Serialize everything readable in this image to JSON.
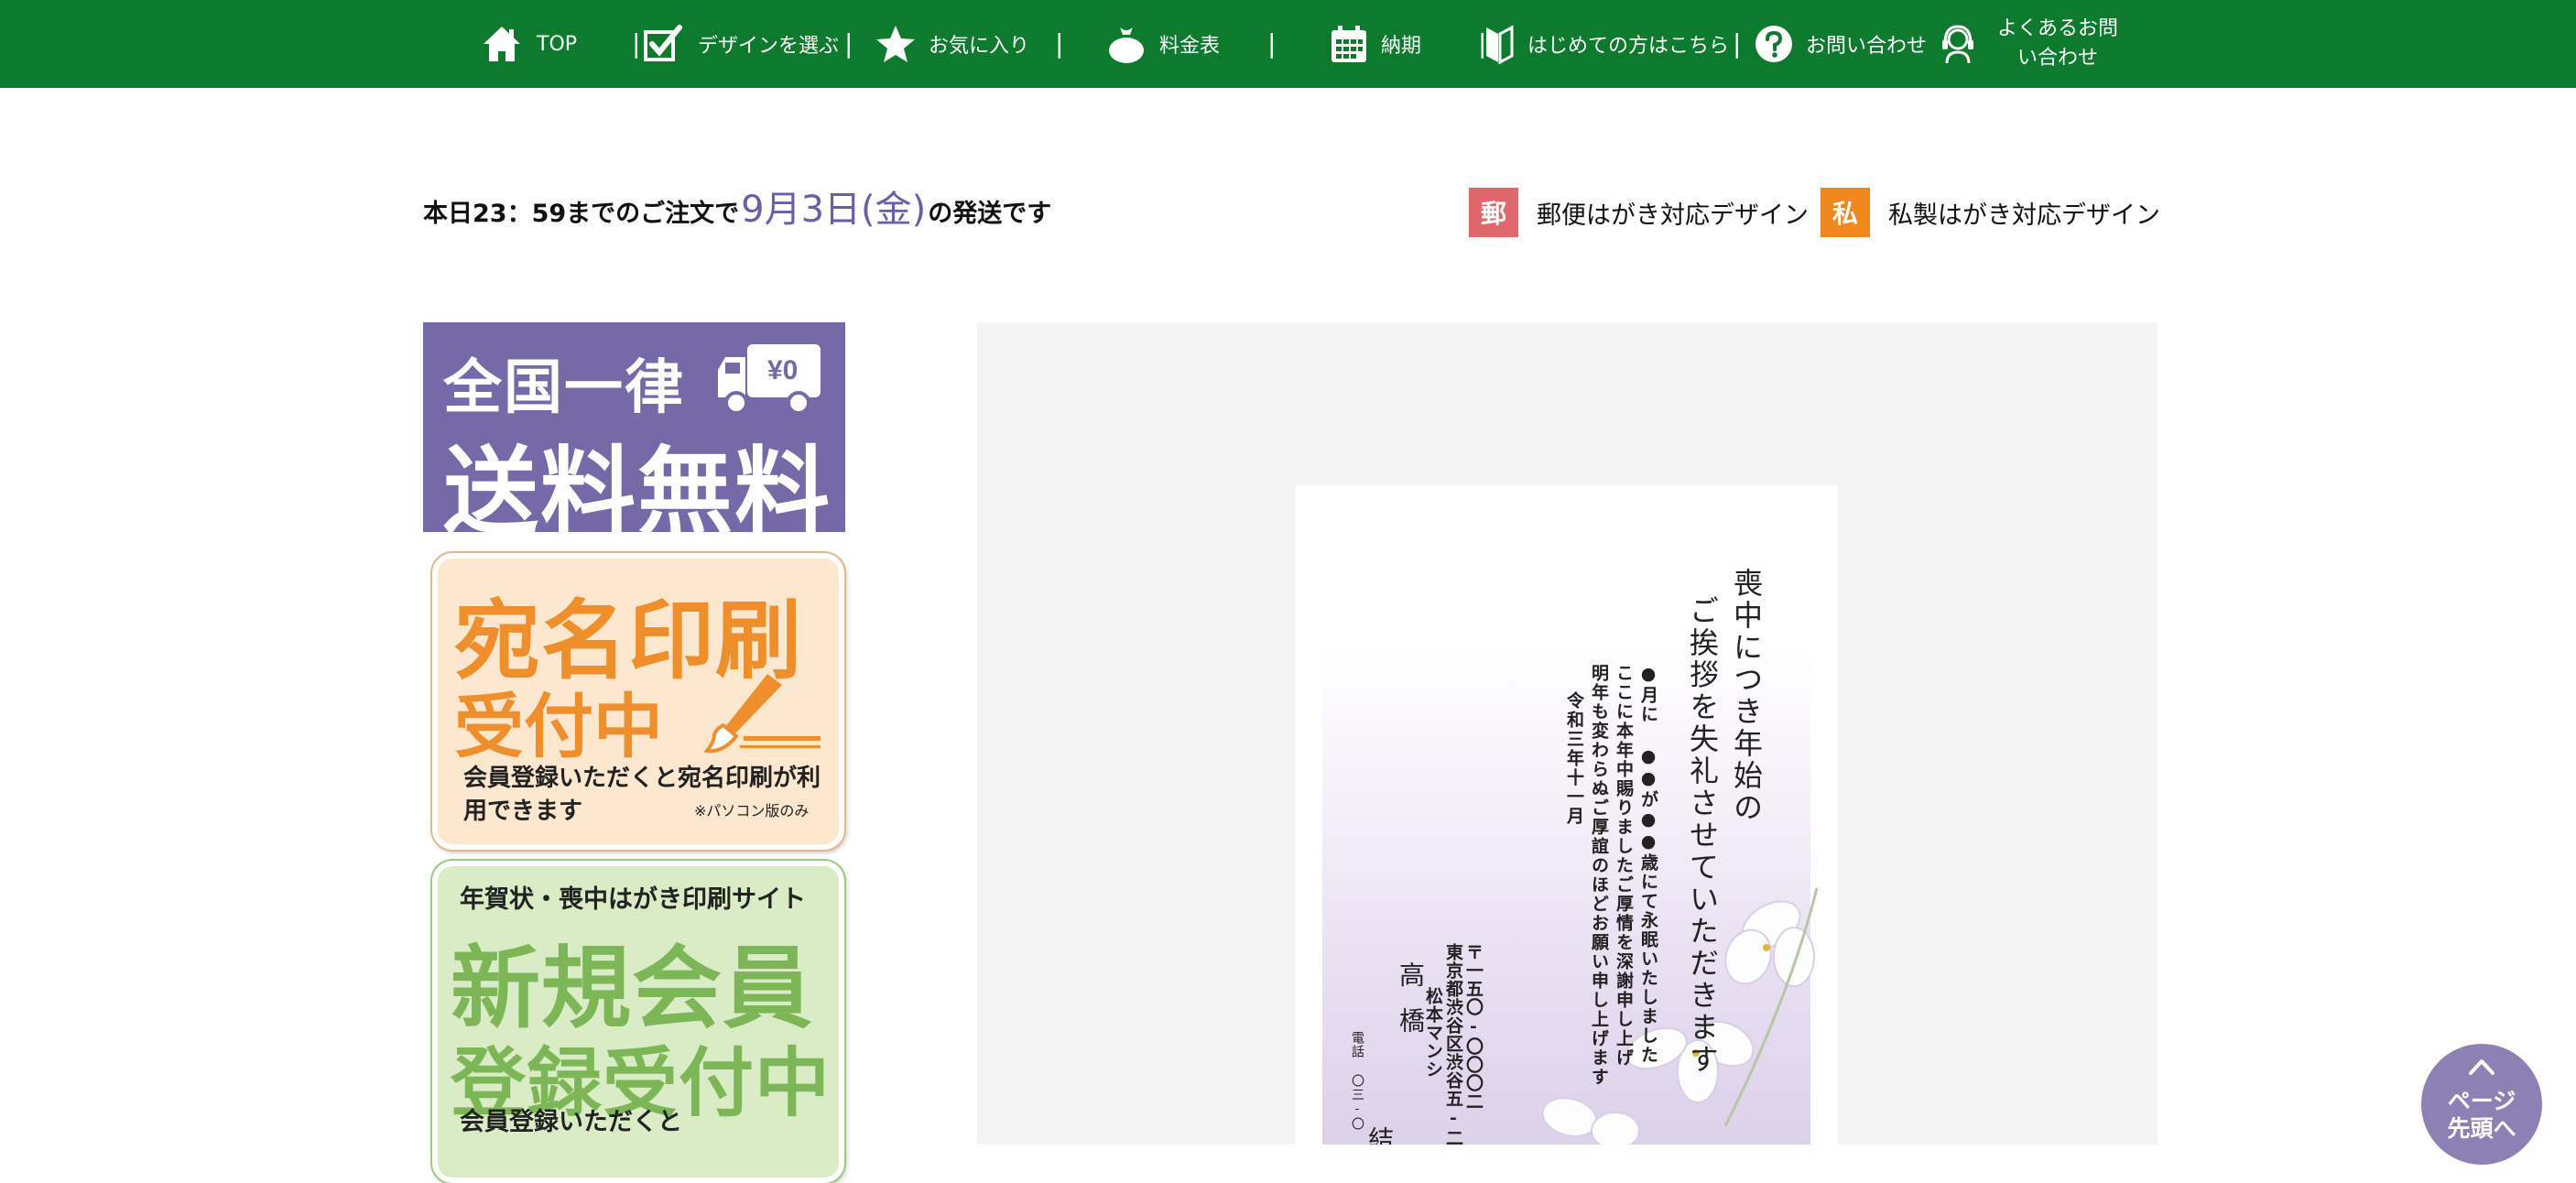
{
  "nav": {
    "items": [
      {
        "label": "TOP",
        "icon": "home-icon"
      },
      {
        "label": "デザインを選ぶ",
        "icon": "checkbox-icon"
      },
      {
        "label": "お気に入り",
        "icon": "star-icon"
      },
      {
        "label": "料金表",
        "icon": "money-bag-icon"
      },
      {
        "label": "納期",
        "icon": "calendar-icon"
      },
      {
        "label": "はじめての方はこちら",
        "icon": "beginner-mark-icon"
      },
      {
        "label": "お問い合わせ",
        "icon": "question-icon"
      },
      {
        "label": "よくあるお問い合わせ",
        "icon": "headset-icon"
      }
    ],
    "separator": "|"
  },
  "deadline": {
    "prefix": "本日23：59までのご注文で",
    "date": "9月3日(金)",
    "suffix": "の発送です"
  },
  "legend": {
    "postal": {
      "badge": "郵",
      "label": "郵便はがき対応デザイン",
      "color": "#e0686c"
    },
    "private": {
      "badge": "私",
      "label": "私製はがき対応デザイン",
      "color": "#f1871f"
    }
  },
  "banners": {
    "shipping": {
      "line1": "全国一律",
      "line2": "送料無料",
      "truck_text": "¥0"
    },
    "address_print": {
      "line1": "宛名印刷",
      "line2": "受付中",
      "desc": "会員登録いただくと宛名印刷が利用できます",
      "note": "※パソコン版のみ"
    },
    "member": {
      "line1": "年賀状・喪中はがき印刷サイト",
      "line2": "新規会員",
      "line3": "登録受付中",
      "line4": "会員登録いただくと"
    }
  },
  "card": {
    "title_lines": [
      "喪中につき年始の",
      "ご挨拶を失礼させていただきます"
    ],
    "body_lines": [
      "●月に ●●が●●歳にて永眠いたしました",
      "ここに本年中賜りましたご厚情を深謝申し上げ",
      "明年も変わらぬご厚誼のほどお願い申し上げます",
      "令和三年十一月"
    ],
    "address_lines": [
      "〒一五〇-〇〇〇二",
      "東京都渋谷区渋谷五-二",
      "松本マンシ"
    ],
    "name_lines": [
      "高橋",
      "結賀"
    ],
    "phone": "電話 〇三-〇"
  },
  "page_top": {
    "label_line1": "ページ",
    "label_line2": "先頭へ"
  },
  "colors": {
    "nav_bg": "#0e7a2d",
    "shipping_bg": "#7669a7",
    "date_accent": "#6a5ea8",
    "page_top_bg": "#8c80b5"
  }
}
